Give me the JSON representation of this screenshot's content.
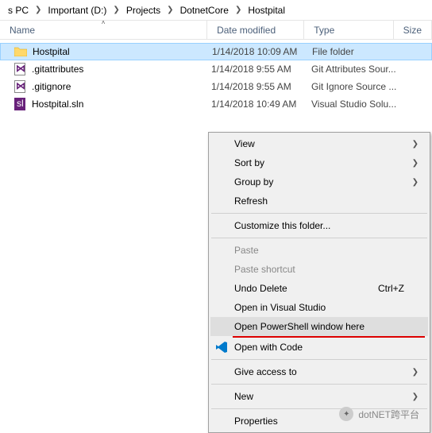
{
  "breadcrumb": [
    "s PC",
    "Important (D:)",
    "Projects",
    "DotnetCore",
    "Hostpital"
  ],
  "columns": {
    "name": "Name",
    "date": "Date modified",
    "type": "Type",
    "size": "Size"
  },
  "files": [
    {
      "icon": "folder",
      "name": "Hostpital",
      "date": "1/14/2018 10:09 AM",
      "type": "File folder",
      "selected": true
    },
    {
      "icon": "vs",
      "name": ".gitattributes",
      "date": "1/14/2018 9:55 AM",
      "type": "Git Attributes Sour...",
      "selected": false
    },
    {
      "icon": "vs",
      "name": ".gitignore",
      "date": "1/14/2018 9:55 AM",
      "type": "Git Ignore Source ...",
      "selected": false
    },
    {
      "icon": "sln",
      "name": "Hostpital.sln",
      "date": "1/14/2018 10:49 AM",
      "type": "Visual Studio Solu...",
      "selected": false
    }
  ],
  "menu": {
    "view": "View",
    "sortby": "Sort by",
    "groupby": "Group by",
    "refresh": "Refresh",
    "customize": "Customize this folder...",
    "paste": "Paste",
    "pasteshortcut": "Paste shortcut",
    "undodelete": "Undo Delete",
    "undodelete_sc": "Ctrl+Z",
    "openvs": "Open in Visual Studio",
    "openps": "Open PowerShell window here",
    "opencode": "Open with Code",
    "giveaccess": "Give access to",
    "new": "New",
    "properties": "Properties"
  },
  "watermark": "dotNET跨平台"
}
